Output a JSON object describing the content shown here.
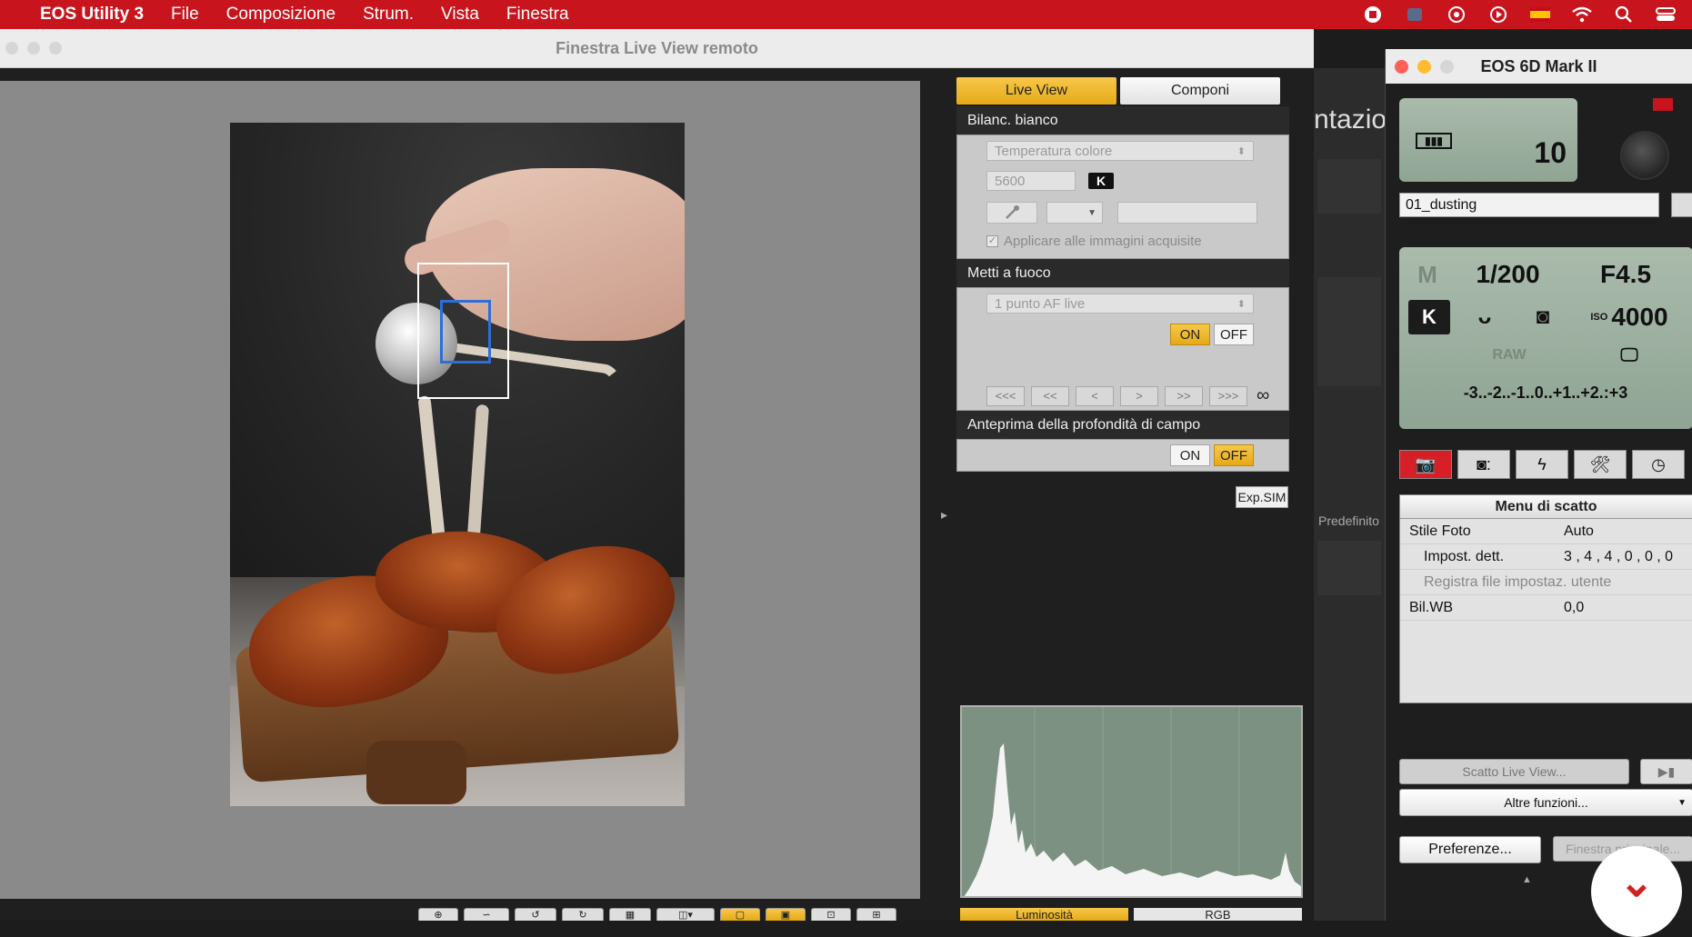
{
  "menubar": {
    "app": "EOS Utility 3",
    "items": [
      "File",
      "Composizione",
      "Strum.",
      "Vista",
      "Finestra"
    ]
  },
  "liveview": {
    "title": "Finestra Live View remoto",
    "tabs": {
      "live_view": "Live View",
      "componi": "Componi"
    },
    "white_balance": {
      "header": "Bilanc. bianco",
      "mode": "Temperatura colore",
      "kelvin": "5600",
      "k_label": "K",
      "apply_label": "Applicare alle immagini acquisite"
    },
    "focus": {
      "header": "Metti a fuoco",
      "af_mode": "1 punto AF live",
      "on": "ON",
      "off": "OFF",
      "nav": [
        "<<<",
        "<<",
        "<",
        ">",
        ">>",
        ">>>"
      ],
      "infinity": "∞"
    },
    "dof": {
      "header": "Anteprima della profondità di campo",
      "on": "ON",
      "off": "OFF"
    },
    "expsim": "Exp.SIM",
    "histogram_tabs": {
      "luminosity": "Luminosità",
      "rgb": "RGB"
    }
  },
  "middle_strip": {
    "partial_text": "ntazior",
    "predefinito": "Predefinito"
  },
  "camera": {
    "title": "EOS 6D Mark II",
    "shots_remaining": "10",
    "folder": "01_dusting",
    "mode": "M",
    "shutter": "1/200",
    "aperture": "F4.5",
    "wb_label": "K",
    "iso_label": "ISO",
    "iso": "4000",
    "raw": "RAW",
    "exposure_scale": "-3..-2..-1..0..+1..+2.:+3",
    "tabs": [
      "camera-red",
      "camera",
      "flash",
      "tools",
      "timer"
    ],
    "menu": {
      "header": "Menu di scatto",
      "rows": [
        {
          "k": "Stile Foto",
          "v": "Auto"
        },
        {
          "k": "Impost. dett.",
          "v": "3 , 4 , 4 , 0 , 0 , 0"
        },
        {
          "k": "Registra file impostaz. utente",
          "v": ""
        },
        {
          "k": "Bil.WB",
          "v": "0,0"
        }
      ]
    },
    "buttons": {
      "live_view_shoot": "Scatto Live View...",
      "other_functions": "Altre funzioni...",
      "preferences": "Preferenze...",
      "main_window": "Finestra principale..."
    }
  },
  "colors": {
    "menubar": "#c8151d",
    "accent_yellow": "#f0b92e",
    "lcd_green": "#9fb2a2"
  }
}
